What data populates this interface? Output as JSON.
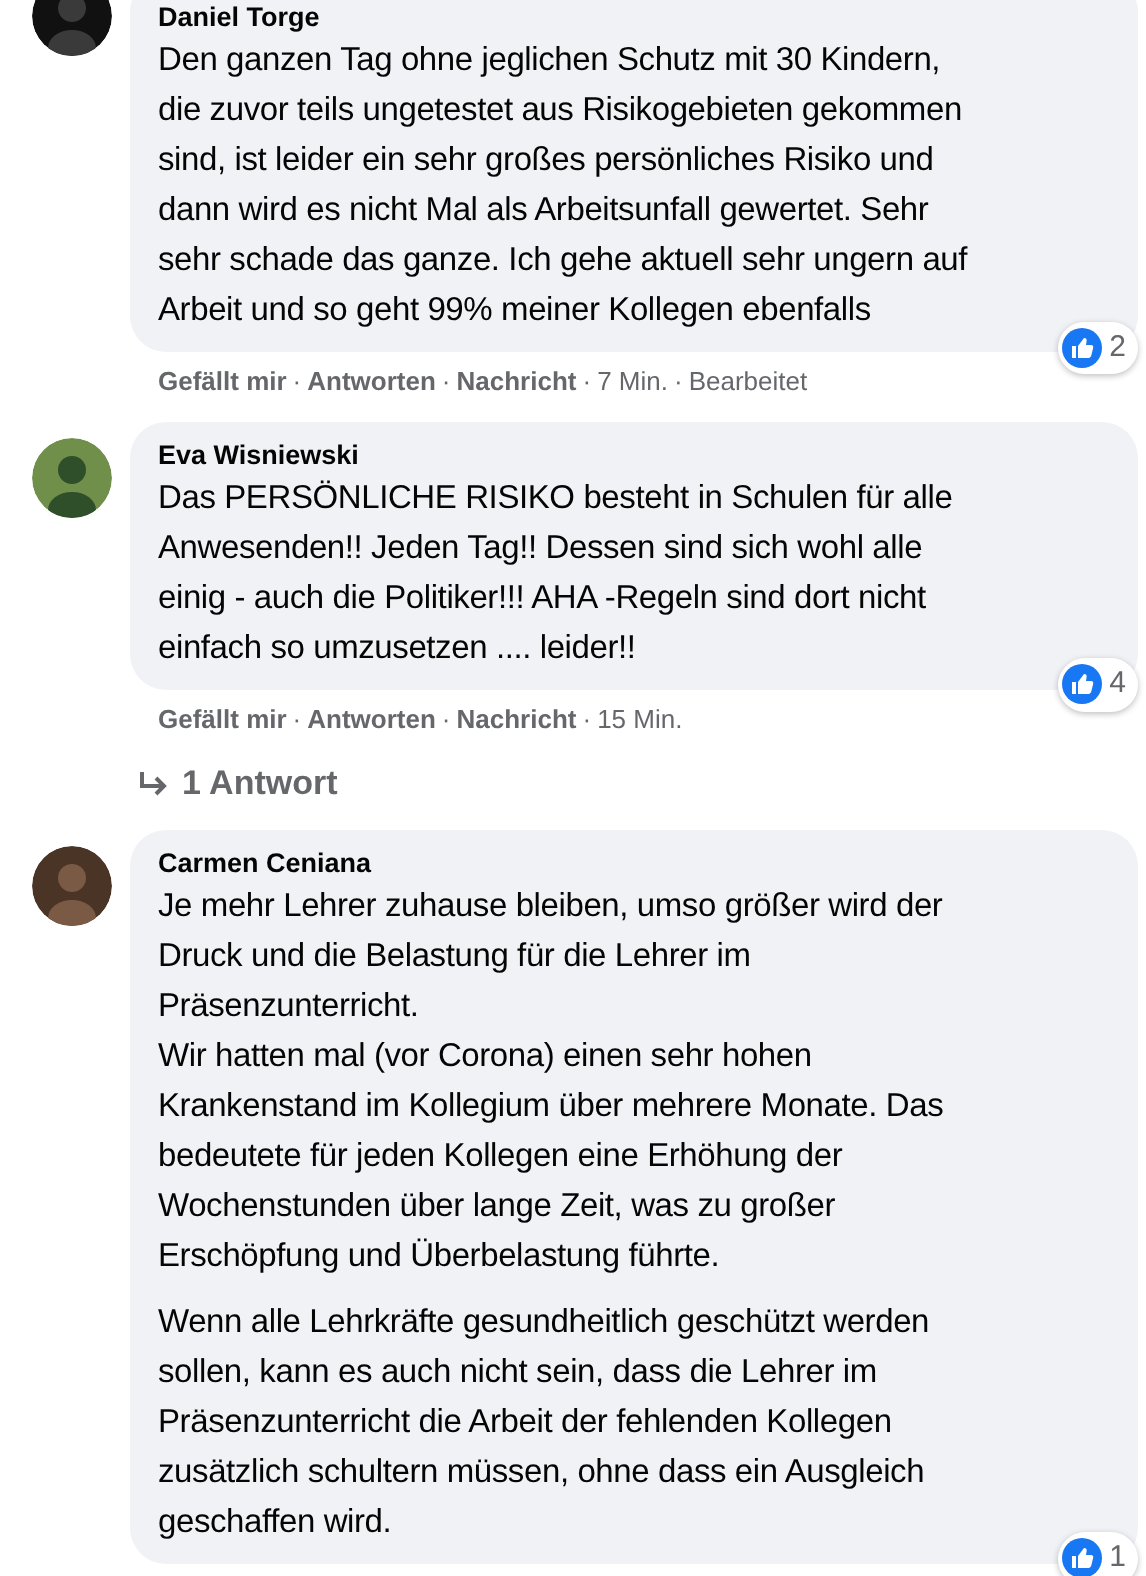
{
  "comments": [
    {
      "author": "Daniel Torge",
      "separator": "·",
      "paragraphs": [
        [
          "Den ganzen Tag ohne jeglichen Schutz mit 30 Kindern,",
          "die zuvor teils ungetestet aus Risikogebieten gekommen",
          "sind, ist leider ein sehr großes persönliches Risiko und",
          "dann wird es nicht Mal als Arbeitsunfall gewertet. Sehr",
          "sehr schade das ganze. Ich gehe aktuell sehr ungern auf",
          "Arbeit und so geht 99% meiner Kollegen ebenfalls"
        ]
      ],
      "actions": [
        "Gefällt mir",
        "Antworten",
        "Nachricht"
      ],
      "time": "7 Min.",
      "edited": "Bearbeitet",
      "reactions": "2"
    },
    {
      "author": "Eva Wisniewski",
      "separator": "·",
      "paragraphs": [
        [
          "Das PERSÖNLICHE RISIKO besteht in Schulen für alle",
          "Anwesenden!! Jeden Tag!! Dessen sind sich wohl alle",
          "einig - auch die Politiker!!! AHA -Regeln sind dort nicht",
          "einfach so umzusetzen .... leider!!"
        ]
      ],
      "actions": [
        "Gefällt mir",
        "Antworten",
        "Nachricht"
      ],
      "time": "15 Min.",
      "reactions": "4",
      "replies": "1 Antwort"
    },
    {
      "author": "Carmen Ceniana",
      "paragraphs": [
        [
          "Je mehr Lehrer zuhause bleiben, umso größer wird der",
          "Druck und die Belastung für die Lehrer im",
          "Präsenzunterricht.",
          "Wir hatten mal (vor Corona) einen sehr hohen",
          "Krankenstand im Kollegium über mehrere Monate. Das",
          "bedeutete für jeden Kollegen eine Erhöhung der",
          "Wochenstunden über lange Zeit, was zu großer",
          "Erschöpfung und Überbelastung führte."
        ],
        [
          "Wenn alle Lehrkräfte gesundheitlich geschützt werden",
          "sollen, kann es auch nicht sein, dass die Lehrer im",
          "Präsenzunterricht die Arbeit der fehlenden Kollegen",
          "zusätzlich schultern müssen, ohne dass ein Ausgleich",
          "geschaffen wird."
        ]
      ],
      "reactions": "1"
    }
  ]
}
